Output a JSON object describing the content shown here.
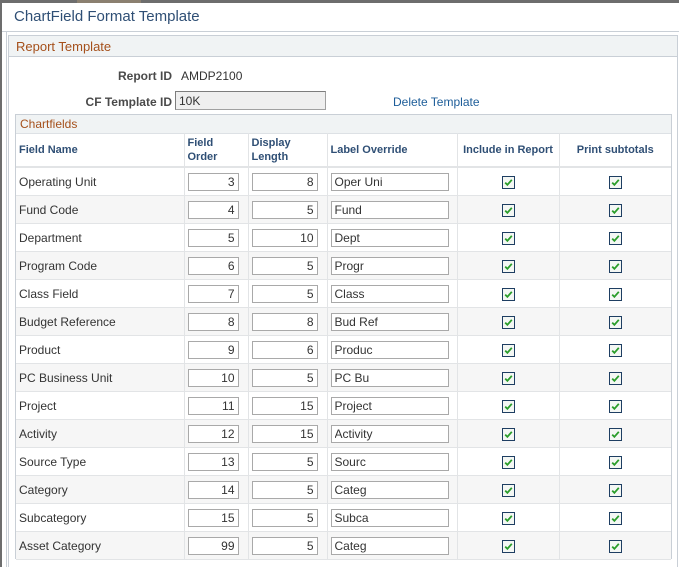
{
  "page": {
    "title": "ChartField Format Template"
  },
  "report_template": {
    "section_title": "Report Template",
    "report_id_label": "Report ID",
    "report_id_value": "AMDP2100",
    "cf_template_id_label": "CF Template ID",
    "cf_template_id_value": "10K",
    "delete_link": "Delete Template"
  },
  "chartfields": {
    "section_title": "Chartfields",
    "columns": {
      "field_name": "Field Name",
      "field_order": "Field Order",
      "display_length": "Display Length",
      "label_override": "Label Override",
      "include_in_report": "Include in Report",
      "print_subtotals": "Print subtotals"
    },
    "rows": [
      {
        "field_name": "Operating Unit",
        "field_order": "3",
        "display_length": "8",
        "label_override": "Oper Uni",
        "include_in_report": true,
        "print_subtotals": true
      },
      {
        "field_name": "Fund Code",
        "field_order": "4",
        "display_length": "5",
        "label_override": "Fund",
        "include_in_report": true,
        "print_subtotals": true
      },
      {
        "field_name": "Department",
        "field_order": "5",
        "display_length": "10",
        "label_override": "Dept",
        "include_in_report": true,
        "print_subtotals": true
      },
      {
        "field_name": "Program Code",
        "field_order": "6",
        "display_length": "5",
        "label_override": "Progr",
        "include_in_report": true,
        "print_subtotals": true
      },
      {
        "field_name": "Class Field",
        "field_order": "7",
        "display_length": "5",
        "label_override": "Class",
        "include_in_report": true,
        "print_subtotals": true
      },
      {
        "field_name": "Budget Reference",
        "field_order": "8",
        "display_length": "8",
        "label_override": "Bud Ref",
        "include_in_report": true,
        "print_subtotals": true
      },
      {
        "field_name": "Product",
        "field_order": "9",
        "display_length": "6",
        "label_override": "Produc",
        "include_in_report": true,
        "print_subtotals": true
      },
      {
        "field_name": "PC Business Unit",
        "field_order": "10",
        "display_length": "5",
        "label_override": "PC Bu",
        "include_in_report": true,
        "print_subtotals": true
      },
      {
        "field_name": "Project",
        "field_order": "11",
        "display_length": "15",
        "label_override": "Project",
        "include_in_report": true,
        "print_subtotals": true
      },
      {
        "field_name": "Activity",
        "field_order": "12",
        "display_length": "15",
        "label_override": "Activity",
        "include_in_report": true,
        "print_subtotals": true
      },
      {
        "field_name": "Source Type",
        "field_order": "13",
        "display_length": "5",
        "label_override": "Sourc",
        "include_in_report": true,
        "print_subtotals": true
      },
      {
        "field_name": "Category",
        "field_order": "14",
        "display_length": "5",
        "label_override": "Categ",
        "include_in_report": true,
        "print_subtotals": true
      },
      {
        "field_name": "Subcategory",
        "field_order": "15",
        "display_length": "5",
        "label_override": "Subca",
        "include_in_report": true,
        "print_subtotals": true
      },
      {
        "field_name": "Asset Category",
        "field_order": "99",
        "display_length": "5",
        "label_override": "Categ",
        "include_in_report": true,
        "print_subtotals": true
      }
    ]
  },
  "icons": {
    "checkbox_checked": "checkmark-icon"
  },
  "colors": {
    "title": "#2f4f75",
    "section_title": "#a5501b",
    "link": "#1d5d99",
    "checkmark": "#2a9d2a"
  }
}
